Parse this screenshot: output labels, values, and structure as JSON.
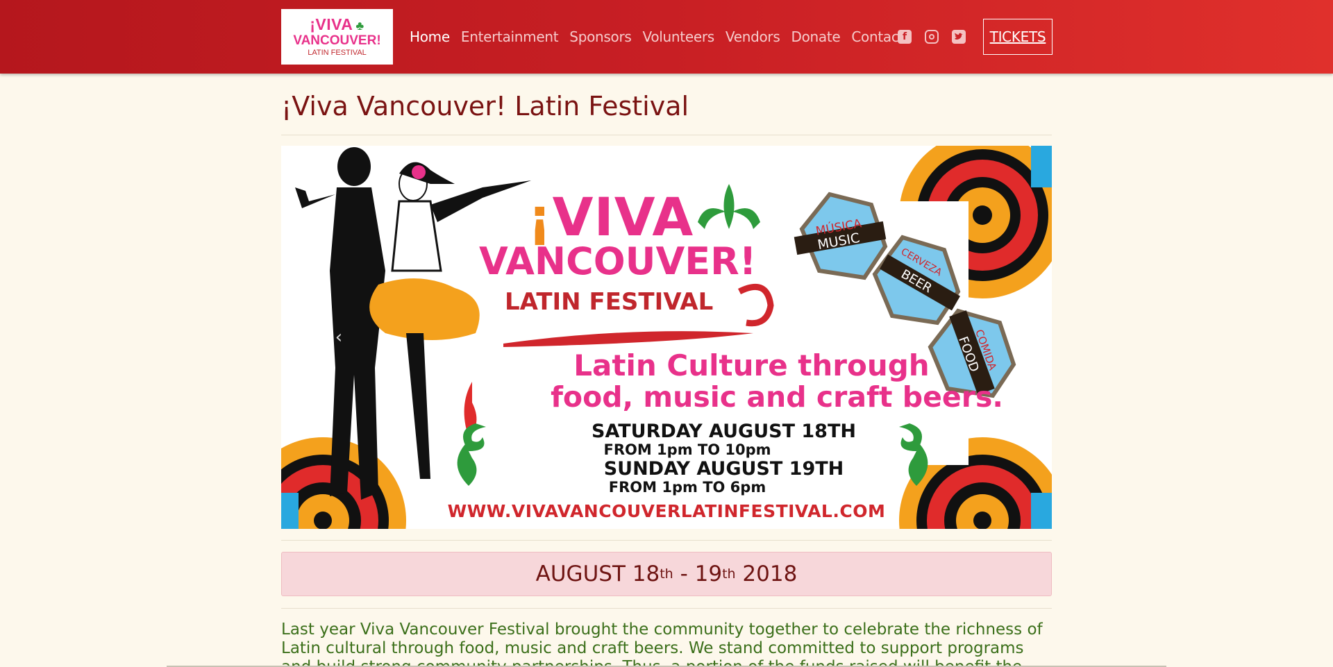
{
  "nav": {
    "logo": {
      "line1": "¡VIVA",
      "line2": "VANCOUVER!",
      "line3": "LATIN FESTIVAL"
    },
    "links": [
      "Home",
      "Entertainment",
      "Sponsors",
      "Volunteers",
      "Vendors",
      "Donate",
      "Contact"
    ],
    "active_link": "Home",
    "social_icons": [
      "facebook-icon",
      "instagram-icon",
      "twitter-icon"
    ],
    "tickets_label": "TICKETS"
  },
  "page": {
    "title": "¡Viva Vancouver! Latin Festival"
  },
  "banner": {
    "viva": "VIVA",
    "viva_mark": "¡",
    "vancouver": "VANCOUVER!",
    "latin_festival": "LATIN FESTIVAL",
    "tagline_1": "Latin Culture through",
    "tagline_2": "food, music and craft beers.",
    "day1": "SATURDAY AUGUST 18TH",
    "day1_time": "FROM 1pm TO 10pm",
    "day2": "SUNDAY AUGUST 19TH",
    "day2_time": "FROM 1pm TO 6pm",
    "url": "WWW.VIVAVANCOUVERLATINFESTIVAL.COM",
    "badges": [
      {
        "top": "MÚSICA",
        "bottom": "MUSIC"
      },
      {
        "top": "CERVEZA",
        "bottom": "BEER"
      },
      {
        "top": "COMIDA",
        "bottom": "FOOD"
      }
    ]
  },
  "dates": {
    "month": "AUGUST",
    "start": "18",
    "start_sup": "th",
    "sep": "-",
    "end": "19",
    "end_sup": "th",
    "year": "2018"
  },
  "intro_text": "Last year Viva Vancouver Festival brought the community together to celebrate the richness of Latin cultural through food, music and craft beers. We stand committed to support programs and build strong community partnerships. Thus, a portion of the funds raised will benefit the multiple",
  "colors": {
    "nav_red": "#c81f24",
    "title_red": "#7a1312",
    "cream_bg": "#fdf8ec",
    "date_pink": "#f7d7da",
    "text_green": "#3b6f1a",
    "magenta": "#e8318a"
  }
}
